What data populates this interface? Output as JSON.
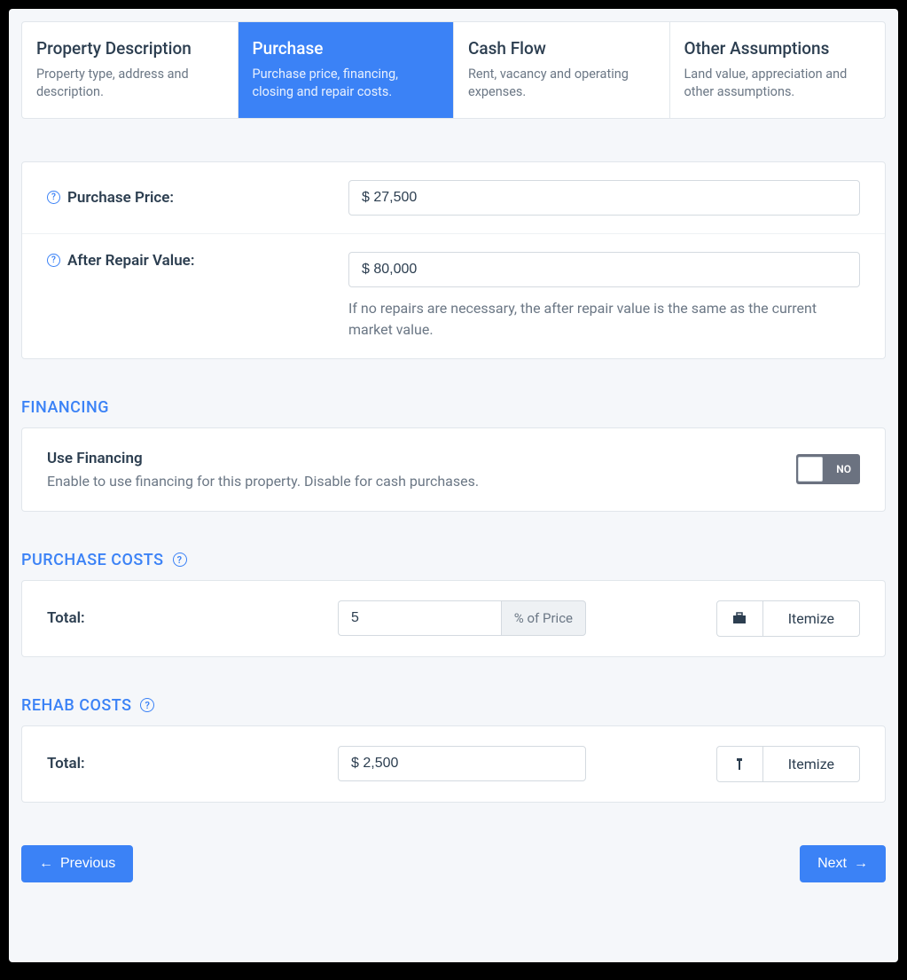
{
  "tabs": [
    {
      "title": "Property Description",
      "sub": "Property type, address and description."
    },
    {
      "title": "Purchase",
      "sub": "Purchase price, financing, closing and repair costs."
    },
    {
      "title": "Cash Flow",
      "sub": "Rent, vacancy and operating expenses."
    },
    {
      "title": "Other Assumptions",
      "sub": "Land value, appreciation and other assumptions."
    }
  ],
  "fields": {
    "purchase_price_label": "Purchase Price:",
    "purchase_price_value": "$ 27,500",
    "arv_label": "After Repair Value:",
    "arv_value": "$ 80,000",
    "arv_hint": "If no repairs are necessary, the after repair value is the same as the current market value."
  },
  "financing": {
    "section": "FINANCING",
    "title": "Use Financing",
    "sub": "Enable to use financing for this property. Disable for cash purchases.",
    "toggle": "NO"
  },
  "purchase_costs": {
    "section": "PURCHASE COSTS",
    "label": "Total:",
    "value": "5",
    "unit": "%  of Price",
    "itemize": "Itemize"
  },
  "rehab_costs": {
    "section": "REHAB COSTS",
    "label": "Total:",
    "value": "$ 2,500",
    "itemize": "Itemize"
  },
  "nav": {
    "prev": "Previous",
    "next": "Next"
  }
}
